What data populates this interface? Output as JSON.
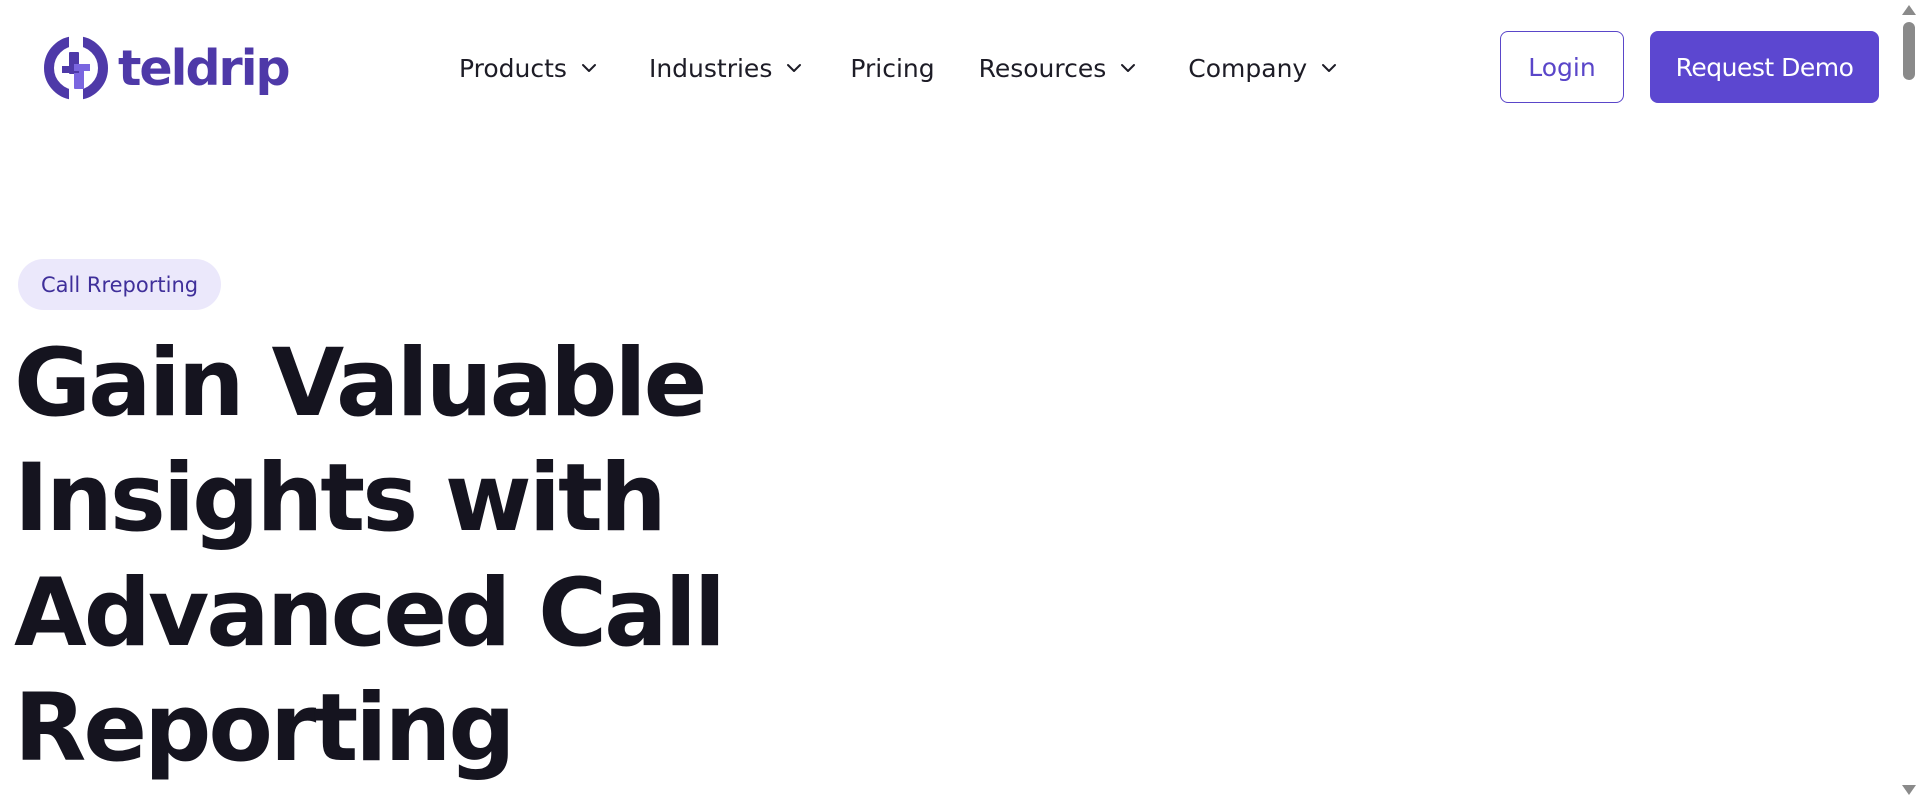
{
  "brand": {
    "name": "teldrip",
    "logo_icon": "teldrip-logo-mark",
    "color": "#4e39a8"
  },
  "nav": {
    "items": [
      {
        "label": "Products",
        "has_dropdown": true
      },
      {
        "label": "Industries",
        "has_dropdown": true
      },
      {
        "label": "Pricing",
        "has_dropdown": false
      },
      {
        "label": "Resources",
        "has_dropdown": true
      },
      {
        "label": "Company",
        "has_dropdown": true
      }
    ],
    "dropdown_icon": "chevron-down-icon"
  },
  "actions": {
    "login_label": "Login",
    "demo_label": "Request Demo"
  },
  "hero": {
    "badge": "Call Rreporting",
    "title_lines": [
      "Gain Valuable",
      "Insights with",
      "Advanced Call",
      "Reporting"
    ]
  },
  "colors": {
    "accent": "#5c47d0",
    "badge_bg": "#ebe8fb",
    "text": "#15141f"
  }
}
